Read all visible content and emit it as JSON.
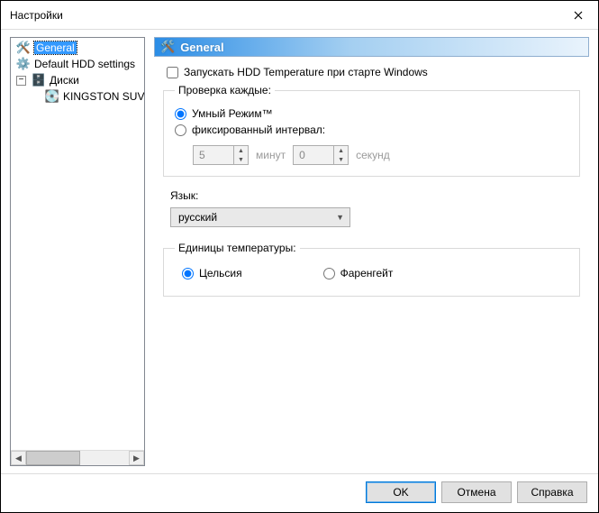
{
  "window": {
    "title": "Настройки"
  },
  "tree": {
    "items": [
      {
        "label": "General"
      },
      {
        "label": "Default HDD settings"
      },
      {
        "label": "Диски"
      },
      {
        "label": "KINGSTON SUV"
      }
    ]
  },
  "banner": {
    "title": "General"
  },
  "startup": {
    "checkbox_label": "Запускать HDD Temperature при старте Windows"
  },
  "check_group": {
    "legend": "Проверка каждые:",
    "radio_smart": "Умный Режим™",
    "radio_interval": "фиксированный интервал:",
    "minutes_value": "5",
    "minutes_unit": "минут",
    "seconds_value": "0",
    "seconds_unit": "секунд"
  },
  "language": {
    "label": "Язык:",
    "selected": "русский"
  },
  "temp_units": {
    "legend": "Единицы температуры:",
    "celsius": "Цельсия",
    "fahrenheit": "Фаренгейт"
  },
  "buttons": {
    "ok": "OK",
    "cancel": "Отмена",
    "help": "Справка"
  }
}
